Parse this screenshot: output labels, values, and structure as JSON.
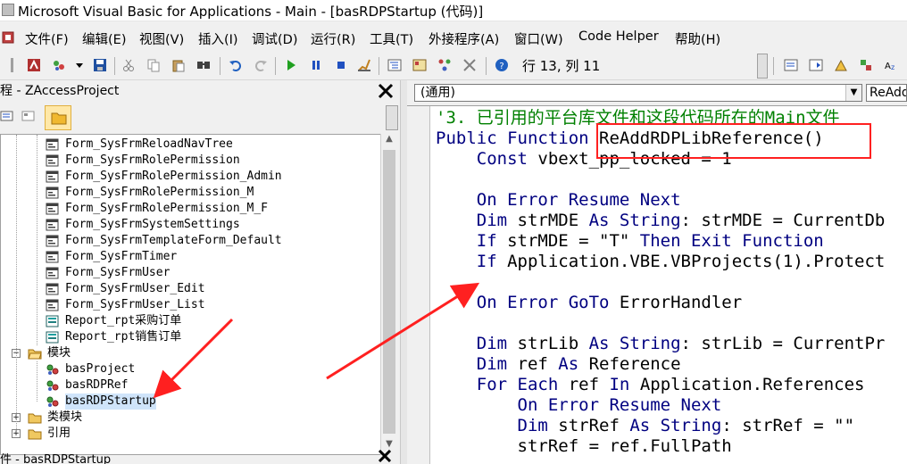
{
  "window": {
    "title": "Microsoft Visual Basic for Applications - Main - [basRDPStartup (代码)]"
  },
  "menu": {
    "items": [
      {
        "label": "文件(F)"
      },
      {
        "label": "编辑(E)"
      },
      {
        "label": "视图(V)"
      },
      {
        "label": "插入(I)"
      },
      {
        "label": "调试(D)"
      },
      {
        "label": "运行(R)"
      },
      {
        "label": "工具(T)"
      },
      {
        "label": "外接程序(A)"
      },
      {
        "label": "窗口(W)"
      },
      {
        "label": "Code Helper"
      },
      {
        "label": "帮助(H)"
      }
    ]
  },
  "toolbar": {
    "position_text": "行 13, 列 11"
  },
  "project": {
    "title": "程 - ZAccessProject",
    "tree": [
      {
        "label": "Form_SysFrmReloadNavTree",
        "icon": "form-icon",
        "level": 2
      },
      {
        "label": "Form_SysFrmRolePermission",
        "icon": "form-icon",
        "level": 2
      },
      {
        "label": "Form_SysFrmRolePermission_Admin",
        "icon": "form-icon",
        "level": 2
      },
      {
        "label": "Form_SysFrmRolePermission_M",
        "icon": "form-icon",
        "level": 2
      },
      {
        "label": "Form_SysFrmRolePermission_M_F",
        "icon": "form-icon",
        "level": 2
      },
      {
        "label": "Form_SysFrmSystemSettings",
        "icon": "form-icon",
        "level": 2
      },
      {
        "label": "Form_SysFrmTemplateForm_Default",
        "icon": "form-icon",
        "level": 2
      },
      {
        "label": "Form_SysFrmTimer",
        "icon": "form-icon",
        "level": 2
      },
      {
        "label": "Form_SysFrmUser",
        "icon": "form-icon",
        "level": 2
      },
      {
        "label": "Form_SysFrmUser_Edit",
        "icon": "form-icon",
        "level": 2
      },
      {
        "label": "Form_SysFrmUser_List",
        "icon": "form-icon",
        "level": 2
      },
      {
        "label": "Report_rpt采购订单",
        "icon": "report-icon",
        "level": 2
      },
      {
        "label": "Report_rpt销售订单",
        "icon": "report-icon",
        "level": 2
      },
      {
        "label": "模块",
        "icon": "folder-open-icon",
        "level": 1,
        "expander": "−"
      },
      {
        "label": "basProject",
        "icon": "module-icon",
        "level": 2
      },
      {
        "label": "basRDPRef",
        "icon": "module-icon",
        "level": 2
      },
      {
        "label": "basRDPStartup",
        "icon": "module-icon",
        "level": 2,
        "selected": true
      },
      {
        "label": "类模块",
        "icon": "folder-icon",
        "level": 1,
        "expander": "+"
      },
      {
        "label": "引用",
        "icon": "folder-icon",
        "level": 1,
        "expander": "+"
      }
    ]
  },
  "properties": {
    "title": "件 - basRDPStartup"
  },
  "code": {
    "object_combo": "(通用)",
    "proc_combo": "ReAdd",
    "lines": [
      [
        {
          "t": "'3. 已引用的平台库文件和这段代码所在的Main文件",
          "c": "cm"
        }
      ],
      [
        {
          "t": "Public Function ",
          "c": "kw"
        },
        {
          "t": "ReAddRDPLibReference()",
          "c": ""
        }
      ],
      [
        {
          "t": "    Const ",
          "c": "kw"
        },
        {
          "t": "vbext_pp_locked = 1",
          "c": ""
        }
      ],
      [
        {
          "t": "",
          "c": ""
        }
      ],
      [
        {
          "t": "    On Error Resume Next",
          "c": "kw"
        }
      ],
      [
        {
          "t": "    Dim ",
          "c": "kw"
        },
        {
          "t": "strMDE ",
          "c": ""
        },
        {
          "t": "As String",
          "c": "kw"
        },
        {
          "t": ": strMDE = CurrentDb",
          "c": ""
        }
      ],
      [
        {
          "t": "    If ",
          "c": "kw"
        },
        {
          "t": "strMDE = \"T\" ",
          "c": ""
        },
        {
          "t": "Then Exit Function",
          "c": "kw"
        }
      ],
      [
        {
          "t": "    If ",
          "c": "kw"
        },
        {
          "t": "Application.VBE.VBProjects(1).Protect",
          "c": ""
        }
      ],
      [
        {
          "t": "",
          "c": ""
        }
      ],
      [
        {
          "t": "    On Error GoTo ",
          "c": "kw"
        },
        {
          "t": "ErrorHandler",
          "c": ""
        }
      ],
      [
        {
          "t": "",
          "c": ""
        }
      ],
      [
        {
          "t": "    Dim ",
          "c": "kw"
        },
        {
          "t": "strLib ",
          "c": ""
        },
        {
          "t": "As String",
          "c": "kw"
        },
        {
          "t": ": strLib = CurrentPr",
          "c": ""
        }
      ],
      [
        {
          "t": "    Dim ",
          "c": "kw"
        },
        {
          "t": "ref ",
          "c": ""
        },
        {
          "t": "As ",
          "c": "kw"
        },
        {
          "t": "Reference",
          "c": ""
        }
      ],
      [
        {
          "t": "    For Each ",
          "c": "kw"
        },
        {
          "t": "ref ",
          "c": ""
        },
        {
          "t": "In ",
          "c": "kw"
        },
        {
          "t": "Application.References",
          "c": ""
        }
      ],
      [
        {
          "t": "        On Error Resume Next",
          "c": "kw"
        }
      ],
      [
        {
          "t": "        Dim ",
          "c": "kw"
        },
        {
          "t": "strRef ",
          "c": ""
        },
        {
          "t": "As String",
          "c": "kw"
        },
        {
          "t": ": strRef = \"\"",
          "c": ""
        }
      ],
      [
        {
          "t": "        strRef = ref.FullPath",
          "c": ""
        }
      ]
    ]
  },
  "colors": {
    "keyword": "#000080",
    "comment": "#008000",
    "annotation": "#ff2020",
    "selection": "#cfe4fa"
  }
}
